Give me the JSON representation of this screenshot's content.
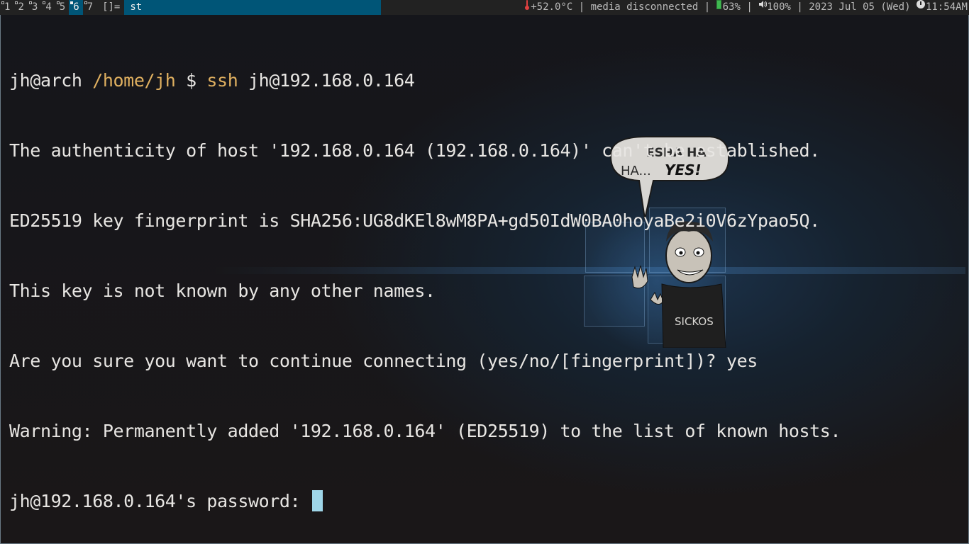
{
  "bar": {
    "tags": [
      {
        "label": "1",
        "occupied": true,
        "selected": false
      },
      {
        "label": "2",
        "occupied": true,
        "selected": false
      },
      {
        "label": "3",
        "occupied": true,
        "selected": false
      },
      {
        "label": "4",
        "occupied": true,
        "selected": false
      },
      {
        "label": "5",
        "occupied": true,
        "selected": false
      },
      {
        "label": "6",
        "occupied": true,
        "selected": true
      },
      {
        "label": "7",
        "occupied": true,
        "selected": false
      }
    ],
    "layout_symbol": "[]=",
    "window_title": "st",
    "status": {
      "temperature": "+52.0°C",
      "sep": "|",
      "network": "media disconnected",
      "battery": "63%",
      "volume": "100%",
      "date": "2023 Jul 05 (Wed)",
      "time": "11:54AM"
    },
    "icons": {
      "temperature": "thermometer-icon",
      "battery": "battery-icon",
      "volume": "speaker-icon",
      "time": "clock-icon"
    },
    "colors": {
      "bar_bg": "#222222",
      "selected_bg": "#005577"
    }
  },
  "terminal": {
    "prompt": {
      "user_host": "jh@arch",
      "path": "/home/jh",
      "symbol": "$",
      "command": "ssh",
      "args": "jh@192.168.0.164"
    },
    "lines": [
      "The authenticity of host '192.168.0.164 (192.168.0.164)' can't be established.",
      "ED25519 key fingerprint is SHA256:UG8dKEl8wM8PA+gd50IdW0BA0hoyaBe2i0V6zYpao5Q.",
      "This key is not known by any other names.",
      "Are you sure you want to continue connecting (yes/no/[fingerprint])? yes",
      "Warning: Permanently added '192.168.0.164' (ED25519) to the list of known hosts."
    ],
    "password_prompt": "jh@192.168.0.164's password: ",
    "colors": {
      "fg": "#e8e6e3",
      "accent": "#e0b060",
      "cursor": "#9fd6e8"
    }
  },
  "wallpaper": {
    "speech_bubble": {
      "line1": "ESHA HA",
      "line2": "HA...",
      "emph": "YES!"
    },
    "shirt_text": "SICKOS"
  }
}
